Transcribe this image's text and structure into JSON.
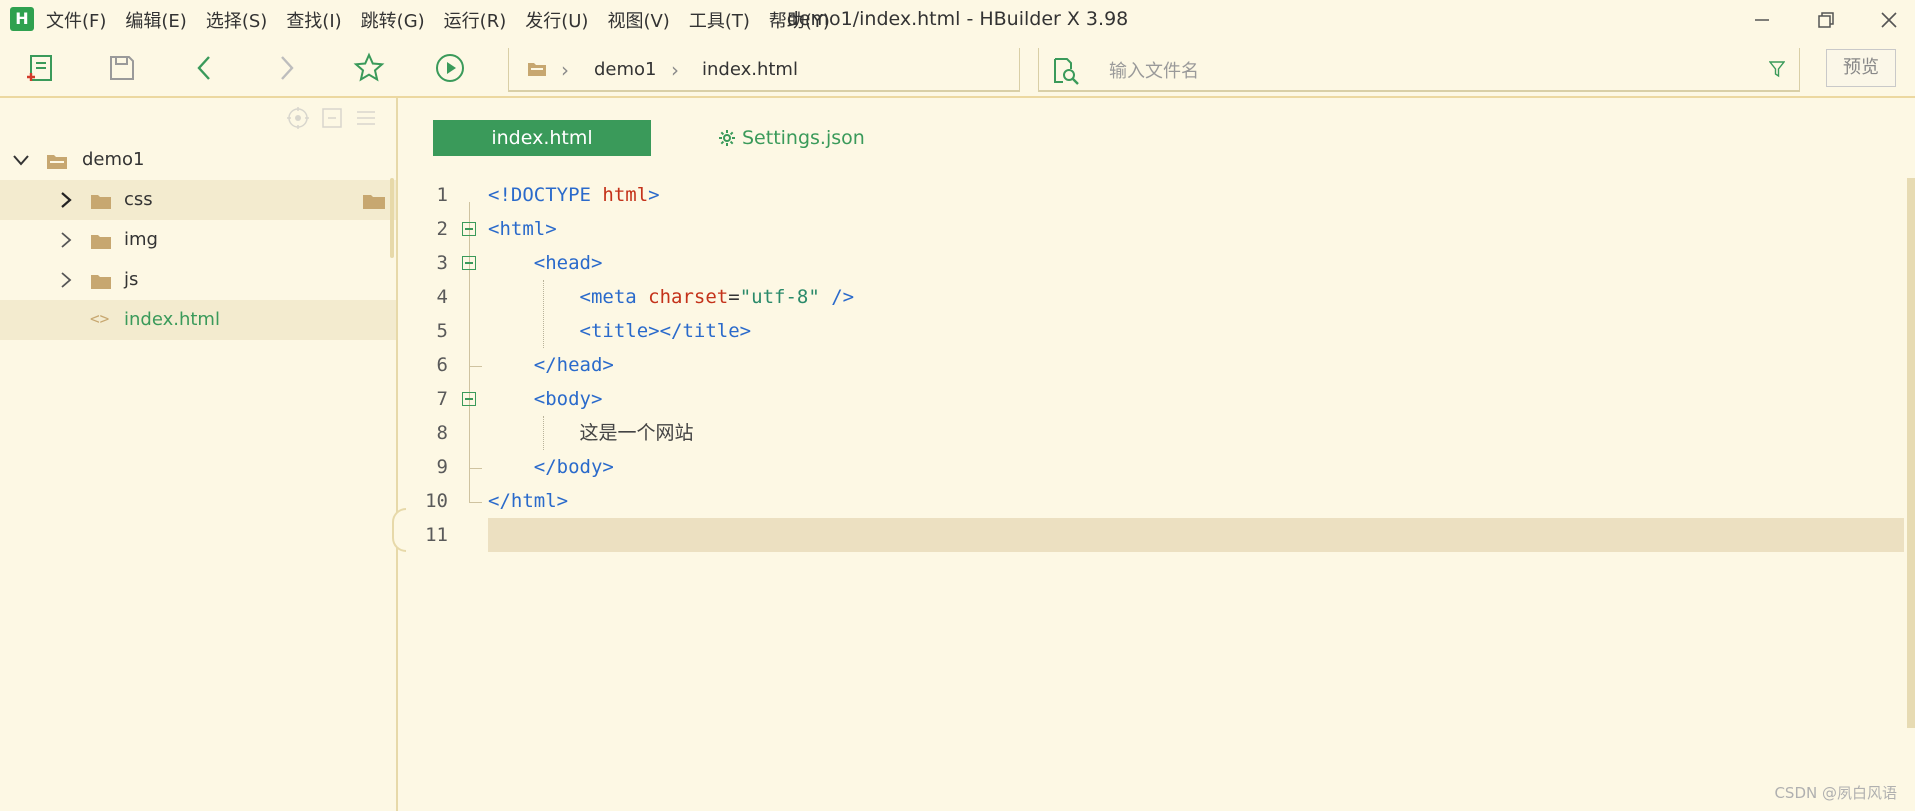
{
  "app": {
    "logo_letter": "H",
    "window_title": "demo1/index.html - HBuilder X 3.98",
    "accent": "#3a9a5a"
  },
  "menu": [
    "文件(F)",
    "编辑(E)",
    "选择(S)",
    "查找(I)",
    "跳转(G)",
    "运行(R)",
    "发行(U)",
    "视图(V)",
    "工具(T)",
    "帮助(Y)"
  ],
  "toolbar": {
    "breadcrumb": [
      "demo1",
      "index.html"
    ],
    "search_placeholder": "输入文件名",
    "preview_label": "预览"
  },
  "sidebar": {
    "project": "demo1",
    "items": [
      {
        "label": "css",
        "type": "folder"
      },
      {
        "label": "img",
        "type": "folder"
      },
      {
        "label": "js",
        "type": "folder"
      },
      {
        "label": "index.html",
        "type": "file"
      }
    ]
  },
  "tabs": [
    {
      "label": "index.html",
      "active": true
    },
    {
      "label": "Settings.json",
      "active": false
    }
  ],
  "editor": {
    "line_numbers": [
      "1",
      "2",
      "3",
      "4",
      "5",
      "6",
      "7",
      "8",
      "9",
      "10",
      "11"
    ],
    "lines": [
      [
        {
          "t": "tag",
          "v": "<!DOCTYPE "
        },
        {
          "t": "attr",
          "v": "html"
        },
        {
          "t": "tag",
          "v": ">"
        }
      ],
      [
        {
          "t": "tag",
          "v": "<html>"
        }
      ],
      [
        {
          "t": "tag",
          "v": "    <head>"
        }
      ],
      [
        {
          "t": "tag",
          "v": "        <meta "
        },
        {
          "t": "attr",
          "v": "charset"
        },
        {
          "t": "plain",
          "v": "="
        },
        {
          "t": "str",
          "v": "\"utf-8\""
        },
        {
          "t": "tag",
          "v": " />"
        }
      ],
      [
        {
          "t": "tag",
          "v": "        <title></title>"
        }
      ],
      [
        {
          "t": "tag",
          "v": "    </head>"
        }
      ],
      [
        {
          "t": "tag",
          "v": "    <body>"
        }
      ],
      [
        {
          "t": "plain",
          "v": "        "
        },
        {
          "t": "txt",
          "v": "这是一个网站"
        }
      ],
      [
        {
          "t": "tag",
          "v": "    </body>"
        }
      ],
      [
        {
          "t": "tag",
          "v": "</html>"
        }
      ],
      []
    ]
  },
  "watermark": "CSDN @夙白风语"
}
